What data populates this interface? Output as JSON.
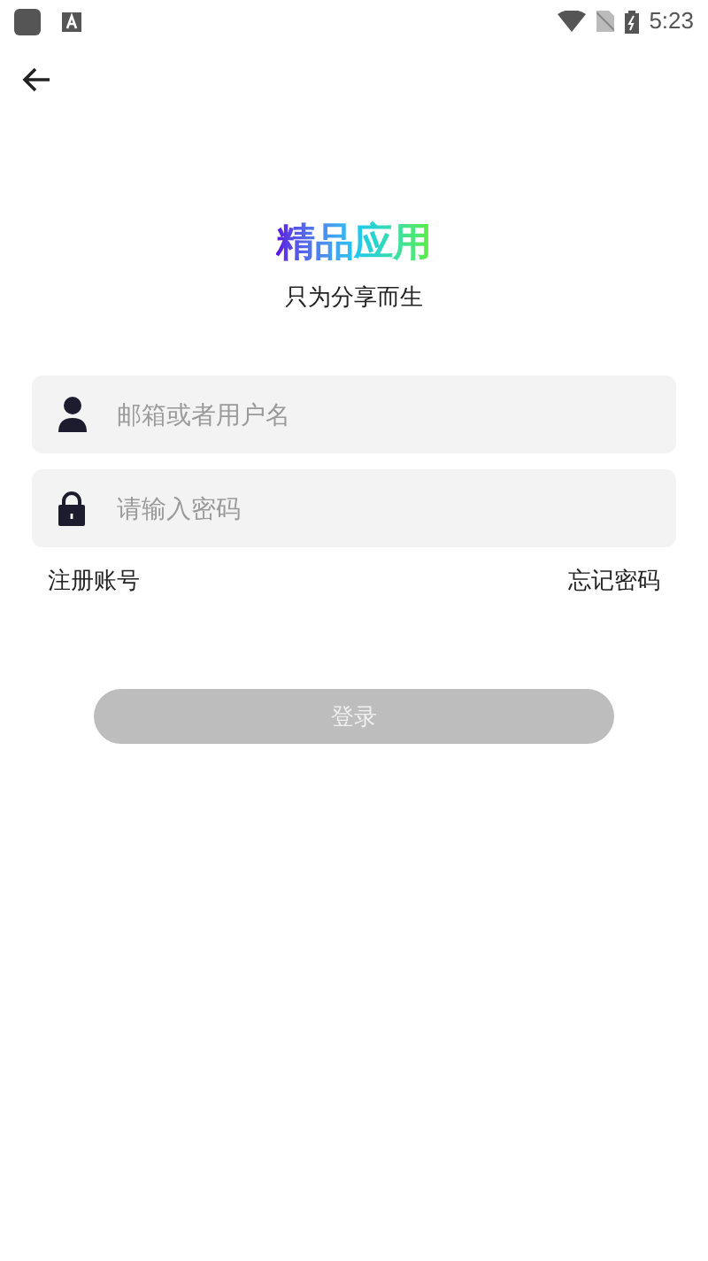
{
  "status_bar": {
    "time": "5:23"
  },
  "header": {
    "title": "精品应用",
    "subtitle": "只为分享而生"
  },
  "fields": [
    {
      "kind": "user",
      "placeholder": "邮箱或者用户名"
    },
    {
      "kind": "password",
      "placeholder": "请输入密码"
    }
  ],
  "links": [
    "注册账号",
    "忘记密码"
  ],
  "login_button": {
    "label": "登录",
    "disabled": true
  }
}
